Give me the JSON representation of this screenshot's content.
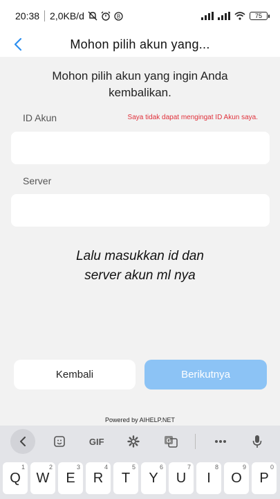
{
  "status_bar": {
    "time": "20:38",
    "speed": "2,0KB/d",
    "battery": "75"
  },
  "header": {
    "title": "Mohon pilih akun yang..."
  },
  "form": {
    "intro": "Mohon pilih akun yang ingin Anda kembalikan.",
    "id_label": "ID Akun",
    "forgot_link": "Saya tidak dapat mengingat ID Akun saya.",
    "id_value": "",
    "server_label": "Server",
    "server_value": ""
  },
  "caption": {
    "line1": "Lalu masukkan id dan",
    "line2": "server akun ml nya"
  },
  "buttons": {
    "back_label": "Kembali",
    "next_label": "Berikutnya"
  },
  "footer": {
    "powered": "Powered by AIHELP.NET"
  },
  "keyboard": {
    "toolbar": [
      "chevron-left-icon",
      "sticker-icon",
      "GIF",
      "gear-icon",
      "translate-icon",
      "more-icon",
      "mic-icon"
    ],
    "gif_label": "GIF",
    "keys": [
      {
        "letter": "Q",
        "hint": "1"
      },
      {
        "letter": "W",
        "hint": "2"
      },
      {
        "letter": "E",
        "hint": "3"
      },
      {
        "letter": "R",
        "hint": "4"
      },
      {
        "letter": "T",
        "hint": "5"
      },
      {
        "letter": "Y",
        "hint": "6"
      },
      {
        "letter": "U",
        "hint": "7"
      },
      {
        "letter": "I",
        "hint": "8"
      },
      {
        "letter": "O",
        "hint": "9"
      },
      {
        "letter": "P",
        "hint": "0"
      }
    ]
  },
  "colors": {
    "accent": "#2b8ff0",
    "next_button": "#8cc3f5",
    "link_red": "#e0313b",
    "background": "#f2f2f2"
  }
}
